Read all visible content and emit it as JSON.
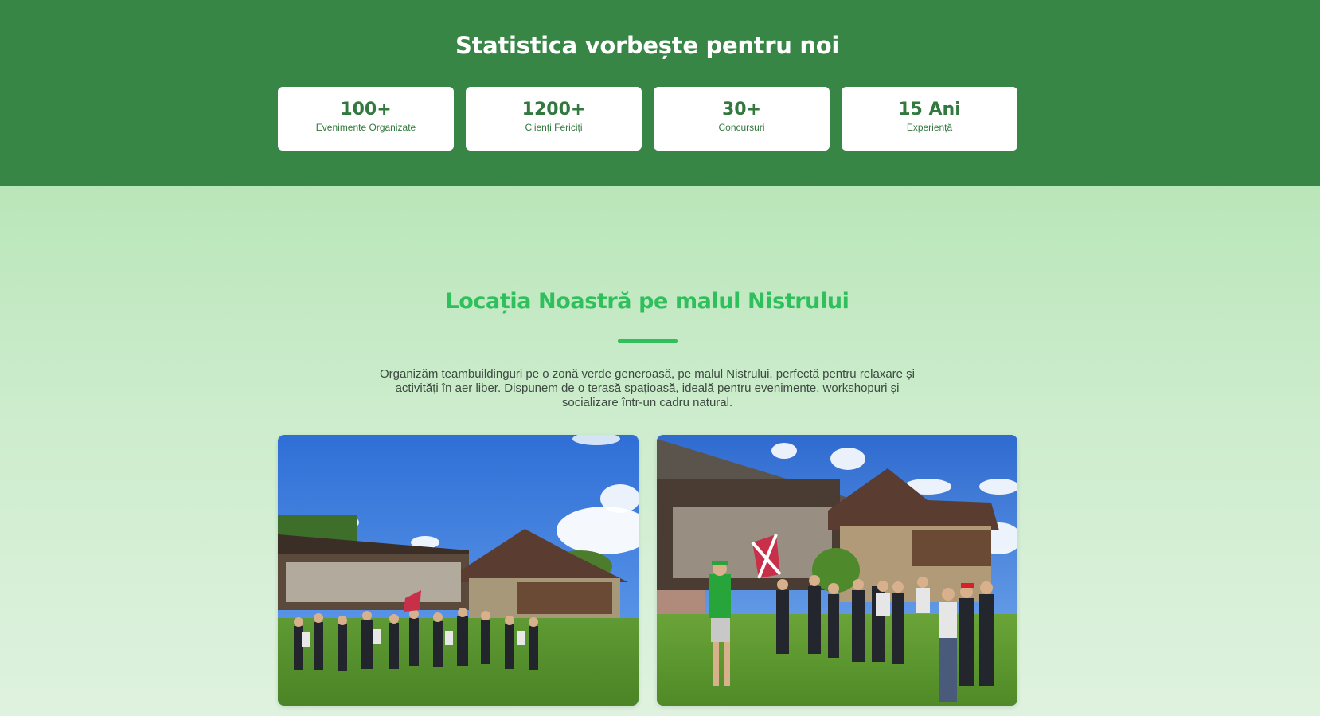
{
  "stats": {
    "title": "Statistica vorbește pentru noi",
    "items": [
      {
        "value": "100+",
        "label": "Evenimente Organizate"
      },
      {
        "value": "1200+",
        "label": "Clienți Fericiți"
      },
      {
        "value": "30+",
        "label": "Concursuri"
      },
      {
        "value": "15 Ani",
        "label": "Experiență"
      }
    ]
  },
  "location": {
    "title": "Locația Noastră pe malul Nistrului",
    "description": "Organizăm teambuildinguri pe o zonă verde generoasă, pe malul Nistrului, perfectă pentru relaxare și activități în aer liber. Dispunem de o terasă spațioasă, ideală pentru evenimente, workshopuri și socializare într-un cadru natural.",
    "photos": [
      {
        "subject": "group-on-lawn-photo"
      },
      {
        "subject": "group-near-terrace-photo"
      }
    ]
  },
  "colors": {
    "stats_bg": "#388645",
    "accent_green": "#2fbf5c",
    "stat_text": "#33793f",
    "page_bg": "#c5eac5"
  }
}
